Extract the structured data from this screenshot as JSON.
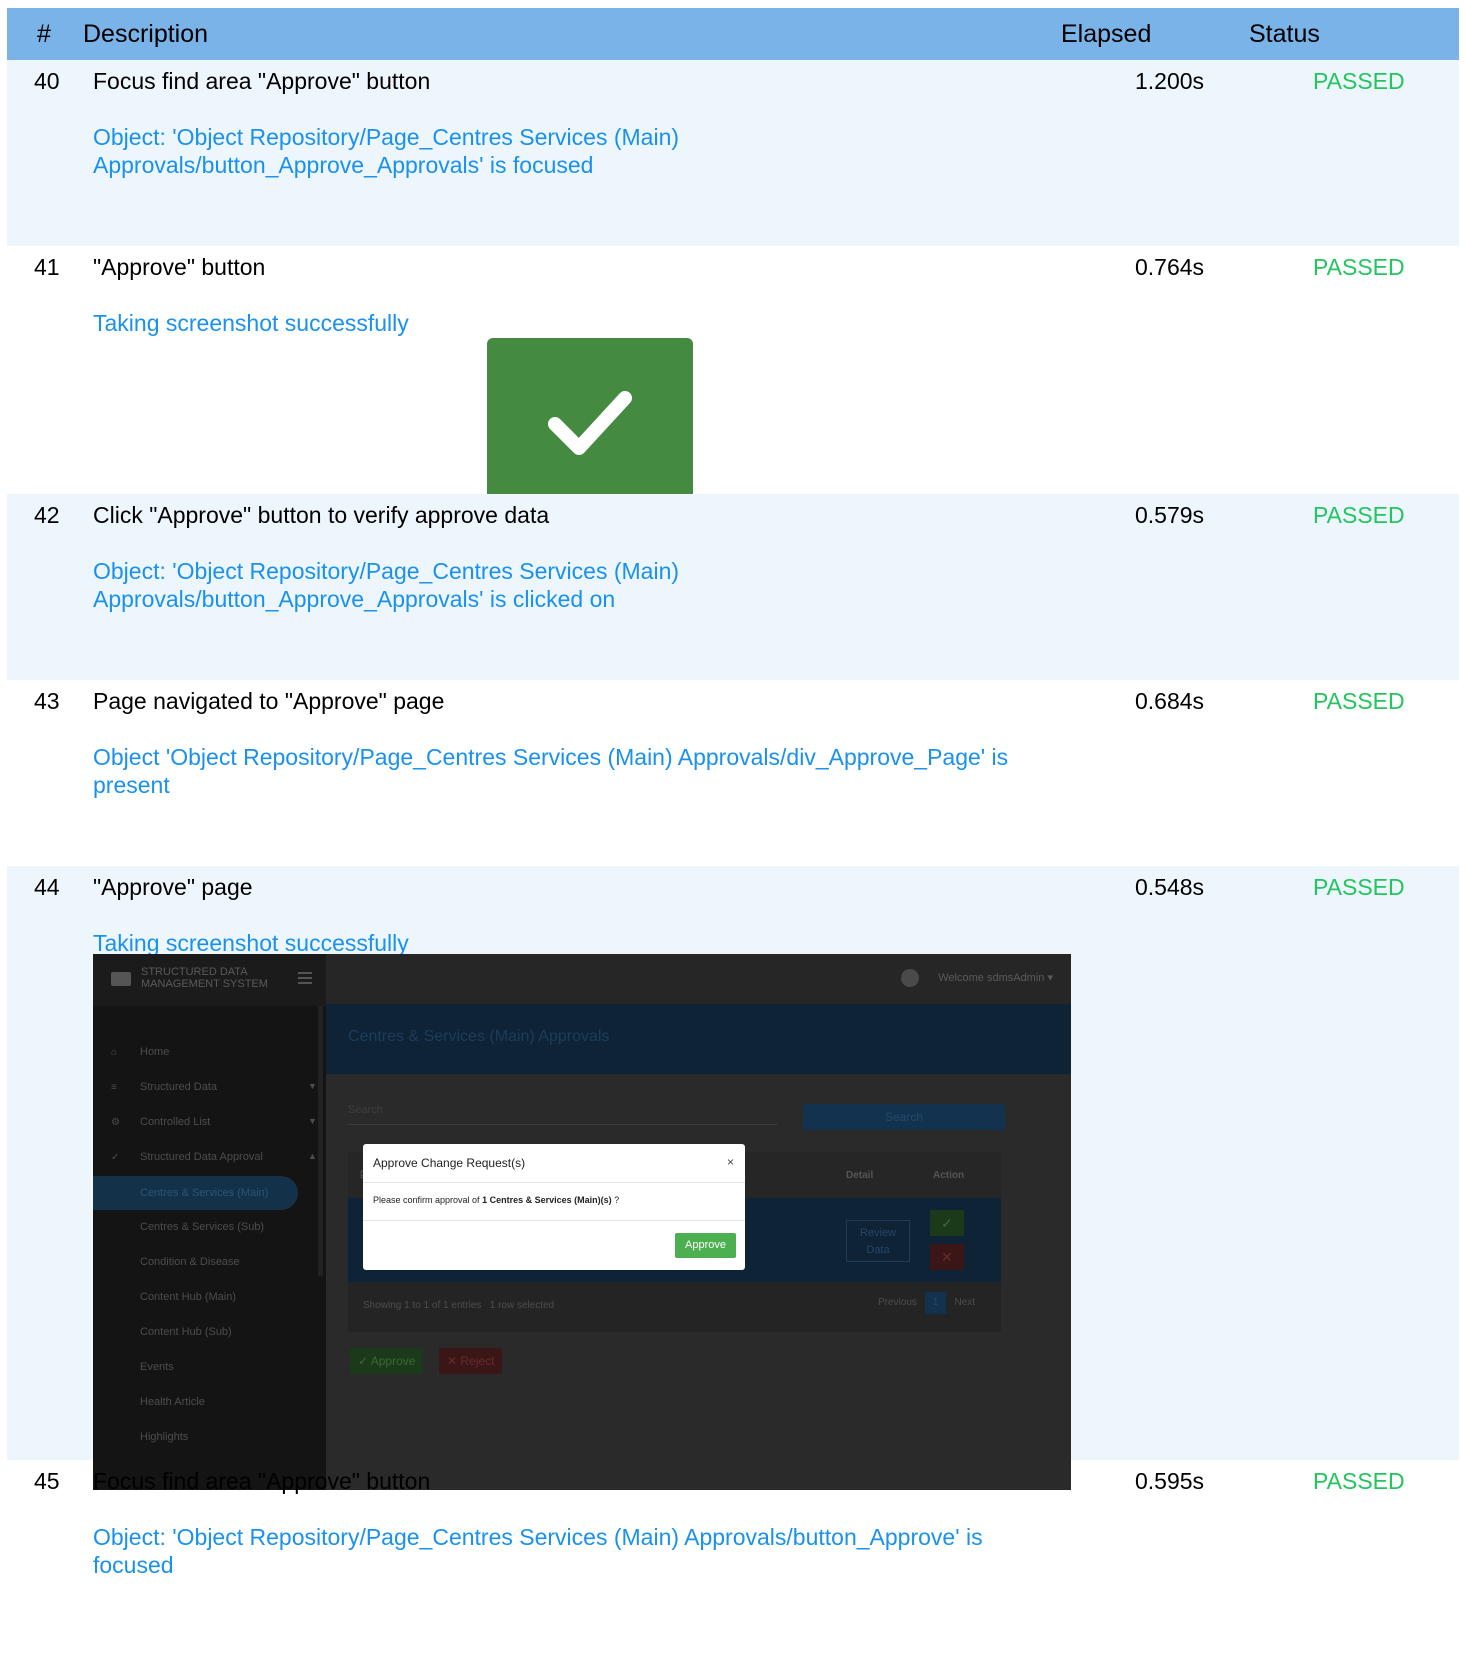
{
  "header": {
    "num": "#",
    "description": "Description",
    "elapsed": "Elapsed",
    "status": "Status"
  },
  "rows": [
    {
      "num": "40",
      "desc": "Focus find area \"Approve\" button",
      "elapsed": "1.200s",
      "status": "PASSED",
      "msg": "Object: 'Object Repository/Page_Centres  Services (Main) Approvals/button_Approve_Approvals' is focused"
    },
    {
      "num": "41",
      "desc": "\"Approve\" button",
      "elapsed": "0.764s",
      "status": "PASSED",
      "msg": "Taking screenshot successfully"
    },
    {
      "num": "42",
      "desc": "Click \"Approve\" button to verify approve data",
      "elapsed": "0.579s",
      "status": "PASSED",
      "msg": "Object: 'Object Repository/Page_Centres  Services (Main) Approvals/button_Approve_Approvals' is clicked on"
    },
    {
      "num": "43",
      "desc": "Page navigated to \"Approve\" page",
      "elapsed": "0.684s",
      "status": "PASSED",
      "msg": "Object 'Object Repository/Page_Centres  Services (Main) Approvals/div_Approve_Page' is present"
    },
    {
      "num": "44",
      "desc": "\"Approve\" page",
      "elapsed": "0.548s",
      "status": "PASSED",
      "msg": "Taking screenshot successfully"
    },
    {
      "num": "45",
      "desc": "Focus find area \"Approve\" button",
      "elapsed": "0.595s",
      "status": "PASSED",
      "msg": "Object: 'Object Repository/Page_Centres  Services (Main) Approvals/button_Approve' is focused"
    }
  ],
  "colors": {
    "header_bg": "#79b3e8",
    "shade_bg": "#eef6fd",
    "passed": "#22c55e",
    "msg": "#1a91ec"
  },
  "app": {
    "brand": "STRUCTURED DATA MANAGEMENT SYSTEM",
    "welcome": "Welcome sdmsAdmin",
    "page_title": "Centres & Services (Main) Approvals",
    "search_placeholder": "Search",
    "search_button": "Search",
    "sidebar": [
      "Home",
      "Structured Data",
      "Controlled List",
      "Structured Data Approval",
      "Centres & Services (Main)",
      "Centres & Services (Sub)",
      "Condition & Disease",
      "Content Hub (Main)",
      "Content Hub (Sub)",
      "Events",
      "Health Article",
      "Highlights"
    ],
    "col_detail": "Detail",
    "col_action": "Action",
    "review_data": "Review Data",
    "showing": "Showing 1 to 1 of 1 entries",
    "selected": "1 row selected",
    "pager": {
      "prev": "Previous",
      "page": "1",
      "next": "Next"
    },
    "approve_label": "Approve",
    "reject_label": "Reject",
    "modal": {
      "title": "Approve Change Request(s)",
      "close": "×",
      "body_prefix": "Please confirm approval of",
      "body_bold": "1 Centres & Services (Main)(s)",
      "body_suffix": "?",
      "button": "Approve"
    }
  }
}
